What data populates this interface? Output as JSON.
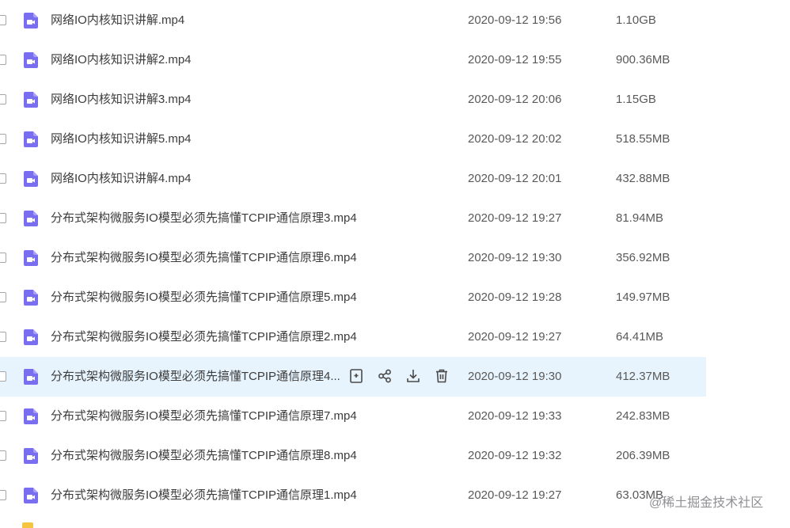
{
  "files": [
    {
      "name": "网络IO内核知识讲解.mp4",
      "date": "2020-09-12 19:56",
      "size": "1.10GB",
      "icon": "video-file-icon"
    },
    {
      "name": "网络IO内核知识讲解2.mp4",
      "date": "2020-09-12 19:55",
      "size": "900.36MB",
      "icon": "video-file-icon"
    },
    {
      "name": "网络IO内核知识讲解3.mp4",
      "date": "2020-09-12 20:06",
      "size": "1.15GB",
      "icon": "video-file-icon"
    },
    {
      "name": "网络IO内核知识讲解5.mp4",
      "date": "2020-09-12 20:02",
      "size": "518.55MB",
      "icon": "video-file-icon"
    },
    {
      "name": "网络IO内核知识讲解4.mp4",
      "date": "2020-09-12 20:01",
      "size": "432.88MB",
      "icon": "video-file-icon"
    },
    {
      "name": "分布式架构微服务IO模型必须先搞懂TCPIP通信原理3.mp4",
      "date": "2020-09-12 19:27",
      "size": "81.94MB",
      "icon": "video-file-icon"
    },
    {
      "name": "分布式架构微服务IO模型必须先搞懂TCPIP通信原理6.mp4",
      "date": "2020-09-12 19:30",
      "size": "356.92MB",
      "icon": "video-file-icon"
    },
    {
      "name": "分布式架构微服务IO模型必须先搞懂TCPIP通信原理5.mp4",
      "date": "2020-09-12 19:28",
      "size": "149.97MB",
      "icon": "video-file-icon"
    },
    {
      "name": "分布式架构微服务IO模型必须先搞懂TCPIP通信原理2.mp4",
      "date": "2020-09-12 19:27",
      "size": "64.41MB",
      "icon": "video-file-icon"
    },
    {
      "name": "分布式架构微服务IO模型必须先搞懂TCPIP通信原理4...",
      "date": "2020-09-12 19:30",
      "size": "412.37MB",
      "icon": "video-file-icon",
      "hovered": true
    },
    {
      "name": "分布式架构微服务IO模型必须先搞懂TCPIP通信原理7.mp4",
      "date": "2020-09-12 19:33",
      "size": "242.83MB",
      "icon": "video-file-icon"
    },
    {
      "name": "分布式架构微服务IO模型必须先搞懂TCPIP通信原理8.mp4",
      "date": "2020-09-12 19:32",
      "size": "206.39MB",
      "icon": "video-file-icon"
    },
    {
      "name": "分布式架构微服务IO模型必须先搞懂TCPIP通信原理1.mp4",
      "date": "2020-09-12 19:27",
      "size": "63.03MB",
      "icon": "video-file-icon"
    }
  ],
  "row_actions": [
    {
      "name": "save-to-device-icon"
    },
    {
      "name": "share-icon"
    },
    {
      "name": "download-icon"
    },
    {
      "name": "delete-icon"
    }
  ],
  "watermark": "@稀土掘金技术社区",
  "colors": {
    "icon_purple": "#7a6ef0",
    "hover_row": "#e8f4fd",
    "text_primary": "#3c3c3c",
    "text_secondary": "#595959",
    "folder_yellow": "#f5c542"
  }
}
